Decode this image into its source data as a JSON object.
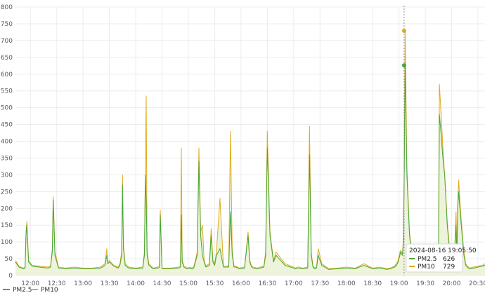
{
  "colors": {
    "pm25": "#46a83a",
    "pm10": "#e0ac1c",
    "grid": "#ececec",
    "area": "#eef3dc",
    "cursor": "#8a8a8a"
  },
  "chart_data": {
    "type": "line",
    "title": "",
    "xlabel": "",
    "ylabel": "",
    "grid": true,
    "legend_position": "bottom-left",
    "ylim": [
      0,
      800
    ],
    "xlim": [
      "11:43",
      "20:38"
    ],
    "y_ticks": [
      "0",
      "50",
      "100",
      "150",
      "200",
      "250",
      "300",
      "350",
      "400",
      "450",
      "500",
      "550",
      "600",
      "650",
      "700",
      "750",
      "800"
    ],
    "x_ticks": [
      "12:00",
      "12:30",
      "13:00",
      "13:30",
      "14:00",
      "14:30",
      "15:00",
      "15:30",
      "16:00",
      "16:30",
      "17:00",
      "17:30",
      "18:00",
      "18:30",
      "19:00",
      "19:30",
      "20:00",
      "20:30"
    ],
    "series": [
      {
        "name": "PM2.5",
        "x": [
          "11:43",
          "11:47",
          "11:52",
          "11:54",
          "11:55",
          "11:56",
          "11:58",
          "12:02",
          "12:10",
          "12:20",
          "12:23",
          "12:25",
          "12:26",
          "12:28",
          "12:32",
          "12:40",
          "12:50",
          "13:00",
          "13:10",
          "13:20",
          "13:25",
          "13:27",
          "13:28",
          "13:30",
          "13:35",
          "13:40",
          "13:42",
          "13:44",
          "13:45",
          "13:46",
          "13:48",
          "13:52",
          "14:00",
          "14:08",
          "14:10",
          "14:11",
          "14:12",
          "14:13",
          "14:15",
          "14:20",
          "14:25",
          "14:27",
          "14:28",
          "14:30",
          "14:40",
          "14:49",
          "14:51",
          "14:52",
          "14:53",
          "14:55",
          "14:57",
          "14:59",
          "15:02",
          "15:04",
          "15:06",
          "15:08",
          "15:10",
          "15:12",
          "15:14",
          "15:16",
          "15:18",
          "15:20",
          "15:24",
          "15:26",
          "15:28",
          "15:30",
          "15:32",
          "15:36",
          "15:40",
          "15:46",
          "15:48",
          "15:50",
          "15:52",
          "15:54",
          "15:58",
          "16:04",
          "16:08",
          "16:10",
          "16:12",
          "16:14",
          "16:18",
          "16:22",
          "16:26",
          "16:28",
          "16:30",
          "16:33",
          "16:37",
          "16:40",
          "16:50",
          "17:00",
          "17:02",
          "17:04",
          "17:06",
          "17:10",
          "17:16",
          "17:18",
          "17:20",
          "17:22",
          "17:24",
          "17:26",
          "17:28",
          "17:32",
          "17:40",
          "17:50",
          "18:00",
          "18:10",
          "18:20",
          "18:30",
          "18:38",
          "18:43",
          "18:46",
          "18:50",
          "18:55",
          "18:57",
          "18:59",
          "19:01",
          "19:02",
          "19:03",
          "19:04",
          "19:05",
          "19:06",
          "19:07",
          "19:09",
          "19:12",
          "19:15",
          "19:20",
          "19:30",
          "19:40",
          "19:42",
          "19:44",
          "19:45",
          "19:46",
          "19:48",
          "19:50",
          "19:52",
          "19:55",
          "19:58",
          "20:00",
          "20:02",
          "20:03",
          "20:05",
          "20:06",
          "20:07",
          "20:08",
          "20:10",
          "20:12",
          "20:14",
          "20:16",
          "20:18",
          "20:20",
          "20:25",
          "20:30",
          "20:35",
          "20:38"
        ],
        "y": [
          40,
          25,
          20,
          22,
          120,
          150,
          40,
          28,
          25,
          22,
          25,
          70,
          225,
          60,
          22,
          20,
          22,
          20,
          20,
          22,
          30,
          60,
          35,
          40,
          28,
          22,
          30,
          60,
          270,
          80,
          30,
          22,
          20,
          22,
          60,
          300,
          220,
          60,
          30,
          20,
          22,
          24,
          180,
          20,
          20,
          22,
          25,
          180,
          40,
          25,
          22,
          20,
          22,
          20,
          22,
          40,
          60,
          340,
          120,
          60,
          40,
          25,
          30,
          120,
          40,
          30,
          60,
          80,
          25,
          25,
          190,
          60,
          25,
          25,
          20,
          22,
          120,
          40,
          25,
          22,
          20,
          22,
          25,
          60,
          380,
          120,
          40,
          60,
          30,
          22,
          20,
          22,
          22,
          20,
          22,
          360,
          60,
          25,
          20,
          22,
          60,
          30,
          18,
          20,
          22,
          20,
          30,
          20,
          22,
          20,
          18,
          20,
          25,
          30,
          40,
          60,
          70,
          65,
          60,
          100,
          300,
          626,
          300,
          120,
          50,
          40,
          35,
          35,
          30,
          30,
          35,
          480,
          420,
          350,
          300,
          150,
          60,
          40,
          30,
          40,
          150,
          60,
          200,
          250,
          180,
          120,
          60,
          30,
          25,
          20,
          22,
          25,
          28,
          30
        ]
      },
      {
        "name": "PM10",
        "x": [
          "11:43",
          "11:47",
          "11:52",
          "11:54",
          "11:55",
          "11:56",
          "11:58",
          "12:02",
          "12:10",
          "12:20",
          "12:23",
          "12:25",
          "12:26",
          "12:28",
          "12:32",
          "12:40",
          "12:50",
          "13:00",
          "13:10",
          "13:20",
          "13:25",
          "13:27",
          "13:28",
          "13:30",
          "13:35",
          "13:40",
          "13:42",
          "13:44",
          "13:45",
          "13:46",
          "13:48",
          "13:52",
          "14:00",
          "14:08",
          "14:10",
          "14:11",
          "14:12",
          "14:13",
          "14:15",
          "14:20",
          "14:25",
          "14:27",
          "14:28",
          "14:30",
          "14:40",
          "14:49",
          "14:51",
          "14:52",
          "14:53",
          "14:55",
          "14:57",
          "14:59",
          "15:02",
          "15:04",
          "15:06",
          "15:08",
          "15:10",
          "15:12",
          "15:14",
          "15:16",
          "15:18",
          "15:20",
          "15:24",
          "15:26",
          "15:28",
          "15:30",
          "15:32",
          "15:36",
          "15:40",
          "15:46",
          "15:48",
          "15:50",
          "15:52",
          "15:54",
          "15:58",
          "16:04",
          "16:08",
          "16:10",
          "16:12",
          "16:14",
          "16:18",
          "16:22",
          "16:26",
          "16:28",
          "16:30",
          "16:33",
          "16:37",
          "16:40",
          "16:50",
          "17:00",
          "17:02",
          "17:04",
          "17:06",
          "17:10",
          "17:16",
          "17:18",
          "17:20",
          "17:22",
          "17:24",
          "17:26",
          "17:28",
          "17:32",
          "17:40",
          "17:50",
          "18:00",
          "18:10",
          "18:20",
          "18:30",
          "18:38",
          "18:43",
          "18:46",
          "18:50",
          "18:55",
          "18:57",
          "18:59",
          "19:01",
          "19:02",
          "19:03",
          "19:04",
          "19:05",
          "19:06",
          "19:07",
          "19:09",
          "19:12",
          "19:15",
          "19:20",
          "19:30",
          "19:40",
          "19:42",
          "19:44",
          "19:45",
          "19:46",
          "19:48",
          "19:50",
          "19:52",
          "19:55",
          "19:58",
          "20:00",
          "20:02",
          "20:03",
          "20:05",
          "20:06",
          "20:07",
          "20:08",
          "20:10",
          "20:12",
          "20:14",
          "20:16",
          "20:18",
          "20:20",
          "20:25",
          "20:30",
          "20:35",
          "20:38"
        ],
        "y": [
          45,
          28,
          22,
          25,
          130,
          160,
          45,
          30,
          28,
          25,
          28,
          80,
          235,
          70,
          25,
          22,
          25,
          22,
          22,
          25,
          35,
          80,
          40,
          45,
          30,
          25,
          35,
          70,
          300,
          90,
          35,
          25,
          22,
          25,
          70,
          315,
          535,
          70,
          35,
          22,
          25,
          28,
          195,
          22,
          22,
          25,
          28,
          380,
          45,
          28,
          25,
          22,
          25,
          22,
          25,
          45,
          70,
          380,
          130,
          150,
          45,
          28,
          35,
          140,
          45,
          35,
          70,
          230,
          28,
          28,
          430,
          70,
          28,
          28,
          22,
          25,
          130,
          45,
          28,
          25,
          22,
          25,
          28,
          70,
          430,
          130,
          45,
          70,
          35,
          25,
          22,
          25,
          25,
          22,
          25,
          445,
          70,
          28,
          22,
          25,
          80,
          35,
          20,
          22,
          25,
          22,
          35,
          22,
          25,
          22,
          20,
          22,
          28,
          35,
          45,
          70,
          75,
          70,
          65,
          110,
          320,
          729,
          320,
          130,
          55,
          45,
          40,
          38,
          35,
          35,
          40,
          570,
          480,
          380,
          300,
          160,
          70,
          45,
          35,
          45,
          190,
          70,
          220,
          285,
          200,
          130,
          70,
          35,
          28,
          22,
          25,
          28,
          30,
          35
        ]
      }
    ],
    "tooltip": {
      "timestamp": "2024-08-16 19:05:50",
      "x": "19:05:50",
      "rows": [
        {
          "series": "PM2.5",
          "value": "626"
        },
        {
          "series": "PM10",
          "value": "729"
        }
      ]
    }
  }
}
